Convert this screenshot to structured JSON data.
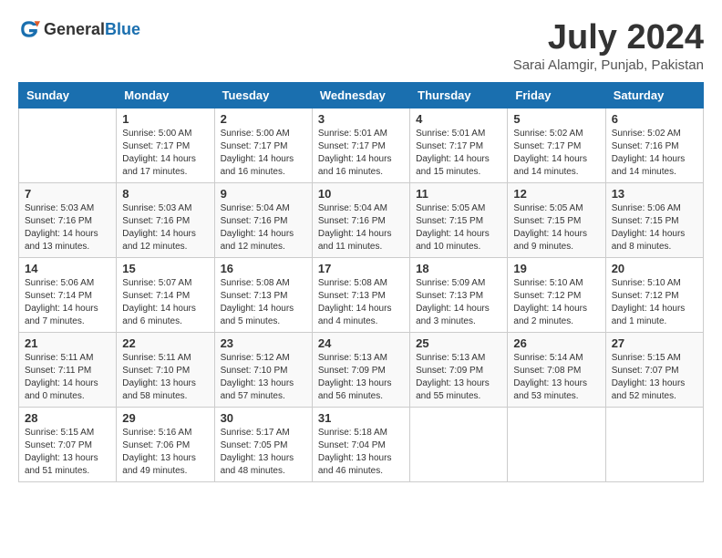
{
  "header": {
    "logo_general": "General",
    "logo_blue": "Blue",
    "month": "July 2024",
    "location": "Sarai Alamgir, Punjab, Pakistan"
  },
  "days_of_week": [
    "Sunday",
    "Monday",
    "Tuesday",
    "Wednesday",
    "Thursday",
    "Friday",
    "Saturday"
  ],
  "weeks": [
    [
      null,
      {
        "day": 1,
        "sunrise": "5:00 AM",
        "sunset": "7:17 PM",
        "daylight": "14 hours and 17 minutes."
      },
      {
        "day": 2,
        "sunrise": "5:00 AM",
        "sunset": "7:17 PM",
        "daylight": "14 hours and 16 minutes."
      },
      {
        "day": 3,
        "sunrise": "5:01 AM",
        "sunset": "7:17 PM",
        "daylight": "14 hours and 16 minutes."
      },
      {
        "day": 4,
        "sunrise": "5:01 AM",
        "sunset": "7:17 PM",
        "daylight": "14 hours and 15 minutes."
      },
      {
        "day": 5,
        "sunrise": "5:02 AM",
        "sunset": "7:17 PM",
        "daylight": "14 hours and 14 minutes."
      },
      {
        "day": 6,
        "sunrise": "5:02 AM",
        "sunset": "7:16 PM",
        "daylight": "14 hours and 14 minutes."
      }
    ],
    [
      {
        "day": 7,
        "sunrise": "5:03 AM",
        "sunset": "7:16 PM",
        "daylight": "14 hours and 13 minutes."
      },
      {
        "day": 8,
        "sunrise": "5:03 AM",
        "sunset": "7:16 PM",
        "daylight": "14 hours and 12 minutes."
      },
      {
        "day": 9,
        "sunrise": "5:04 AM",
        "sunset": "7:16 PM",
        "daylight": "14 hours and 12 minutes."
      },
      {
        "day": 10,
        "sunrise": "5:04 AM",
        "sunset": "7:16 PM",
        "daylight": "14 hours and 11 minutes."
      },
      {
        "day": 11,
        "sunrise": "5:05 AM",
        "sunset": "7:15 PM",
        "daylight": "14 hours and 10 minutes."
      },
      {
        "day": 12,
        "sunrise": "5:05 AM",
        "sunset": "7:15 PM",
        "daylight": "14 hours and 9 minutes."
      },
      {
        "day": 13,
        "sunrise": "5:06 AM",
        "sunset": "7:15 PM",
        "daylight": "14 hours and 8 minutes."
      }
    ],
    [
      {
        "day": 14,
        "sunrise": "5:06 AM",
        "sunset": "7:14 PM",
        "daylight": "14 hours and 7 minutes."
      },
      {
        "day": 15,
        "sunrise": "5:07 AM",
        "sunset": "7:14 PM",
        "daylight": "14 hours and 6 minutes."
      },
      {
        "day": 16,
        "sunrise": "5:08 AM",
        "sunset": "7:13 PM",
        "daylight": "14 hours and 5 minutes."
      },
      {
        "day": 17,
        "sunrise": "5:08 AM",
        "sunset": "7:13 PM",
        "daylight": "14 hours and 4 minutes."
      },
      {
        "day": 18,
        "sunrise": "5:09 AM",
        "sunset": "7:13 PM",
        "daylight": "14 hours and 3 minutes."
      },
      {
        "day": 19,
        "sunrise": "5:10 AM",
        "sunset": "7:12 PM",
        "daylight": "14 hours and 2 minutes."
      },
      {
        "day": 20,
        "sunrise": "5:10 AM",
        "sunset": "7:12 PM",
        "daylight": "14 hours and 1 minute."
      }
    ],
    [
      {
        "day": 21,
        "sunrise": "5:11 AM",
        "sunset": "7:11 PM",
        "daylight": "14 hours and 0 minutes."
      },
      {
        "day": 22,
        "sunrise": "5:11 AM",
        "sunset": "7:10 PM",
        "daylight": "13 hours and 58 minutes."
      },
      {
        "day": 23,
        "sunrise": "5:12 AM",
        "sunset": "7:10 PM",
        "daylight": "13 hours and 57 minutes."
      },
      {
        "day": 24,
        "sunrise": "5:13 AM",
        "sunset": "7:09 PM",
        "daylight": "13 hours and 56 minutes."
      },
      {
        "day": 25,
        "sunrise": "5:13 AM",
        "sunset": "7:09 PM",
        "daylight": "13 hours and 55 minutes."
      },
      {
        "day": 26,
        "sunrise": "5:14 AM",
        "sunset": "7:08 PM",
        "daylight": "13 hours and 53 minutes."
      },
      {
        "day": 27,
        "sunrise": "5:15 AM",
        "sunset": "7:07 PM",
        "daylight": "13 hours and 52 minutes."
      }
    ],
    [
      {
        "day": 28,
        "sunrise": "5:15 AM",
        "sunset": "7:07 PM",
        "daylight": "13 hours and 51 minutes."
      },
      {
        "day": 29,
        "sunrise": "5:16 AM",
        "sunset": "7:06 PM",
        "daylight": "13 hours and 49 minutes."
      },
      {
        "day": 30,
        "sunrise": "5:17 AM",
        "sunset": "7:05 PM",
        "daylight": "13 hours and 48 minutes."
      },
      {
        "day": 31,
        "sunrise": "5:18 AM",
        "sunset": "7:04 PM",
        "daylight": "13 hours and 46 minutes."
      },
      null,
      null,
      null
    ]
  ]
}
